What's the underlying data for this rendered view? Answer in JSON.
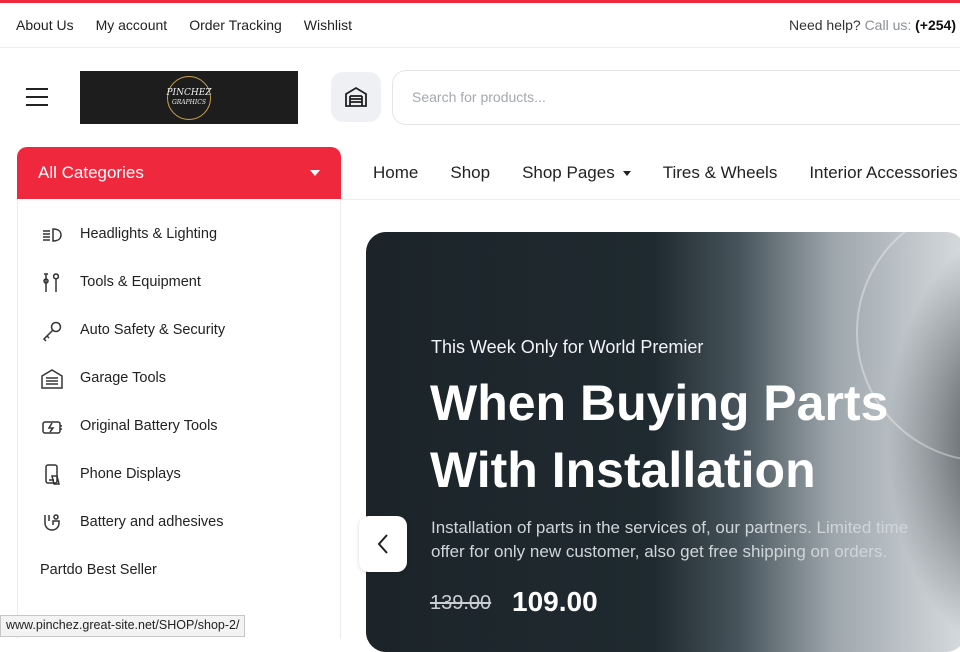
{
  "colors": {
    "accent": "#f0283e",
    "hero_dark": "#1c2429"
  },
  "topbar": {
    "links": [
      "About Us",
      "My account",
      "Order Tracking",
      "Wishlist"
    ],
    "help_text": "Need help?",
    "call_label": "Call us:",
    "phone": "(+254)"
  },
  "header": {
    "menu_icon": "hamburger-icon",
    "logo_text_line1": "PINCHEZ",
    "logo_text_line2": "GRAPHICS",
    "garage_icon": "garage-icon",
    "search_placeholder": "Search for products..."
  },
  "categories": {
    "title": "All Categories",
    "items": [
      {
        "label": "Headlights & Lighting",
        "icon": "headlight-icon"
      },
      {
        "label": "Tools & Equipment",
        "icon": "tools-icon"
      },
      {
        "label": "Auto Safety & Security",
        "icon": "key-icon"
      },
      {
        "label": "Garage Tools",
        "icon": "garage-icon"
      },
      {
        "label": "Original Battery Tools",
        "icon": "battery-icon"
      },
      {
        "label": "Phone Displays",
        "icon": "phone-display-icon"
      },
      {
        "label": "Battery and adhesives",
        "icon": "adhesive-icon"
      }
    ],
    "best_seller": "Partdo Best Seller"
  },
  "nav": {
    "items": [
      {
        "label": "Home"
      },
      {
        "label": "Shop"
      },
      {
        "label": "Shop Pages",
        "dropdown": true
      },
      {
        "label": "Tires & Wheels"
      },
      {
        "label": "Interior Accessories"
      }
    ]
  },
  "hero": {
    "eyebrow": "This Week Only for World Premier",
    "title_line1": "When Buying Parts",
    "title_line2": "With Installation",
    "desc_line1": "Installation of parts in the services of, our partners. Limited time",
    "desc_line2": "offer for only new customer, also get free shipping on orders.",
    "old_price": "139.00",
    "new_price": "109.00",
    "prev_icon": "chevron-left-icon"
  },
  "status_url": "www.pinchez.great-site.net/SHOP/shop-2/"
}
